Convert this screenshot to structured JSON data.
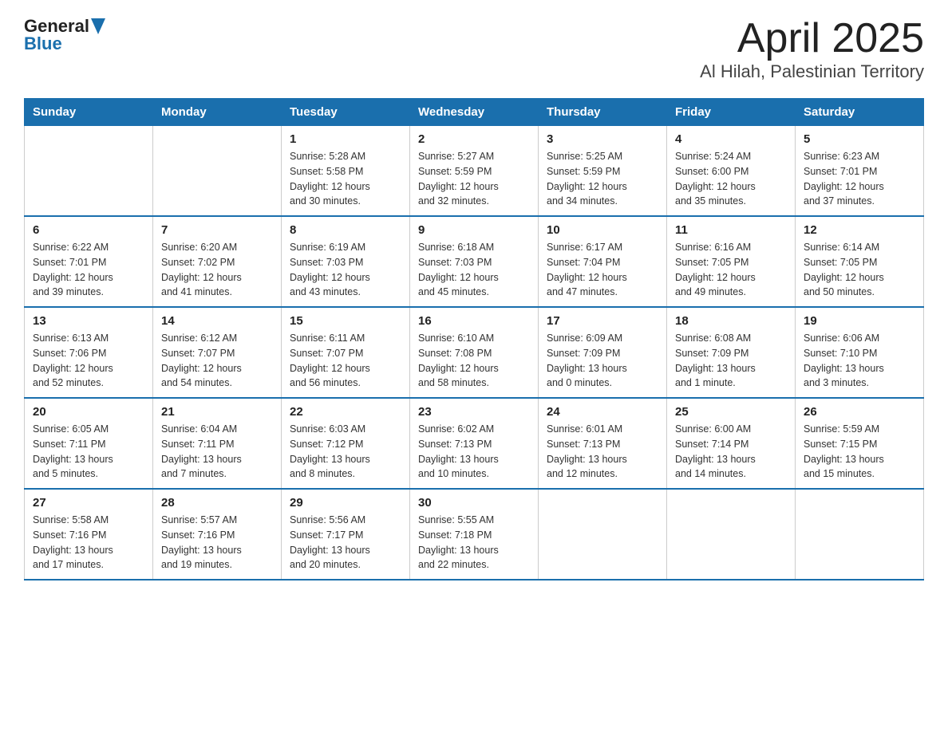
{
  "header": {
    "logo": {
      "general": "General",
      "blue": "Blue"
    },
    "title": "April 2025",
    "subtitle": "Al Hilah, Palestinian Territory"
  },
  "calendar": {
    "days_of_week": [
      "Sunday",
      "Monday",
      "Tuesday",
      "Wednesday",
      "Thursday",
      "Friday",
      "Saturday"
    ],
    "weeks": [
      [
        {
          "day": "",
          "info": ""
        },
        {
          "day": "",
          "info": ""
        },
        {
          "day": "1",
          "info": "Sunrise: 5:28 AM\nSunset: 5:58 PM\nDaylight: 12 hours\nand 30 minutes."
        },
        {
          "day": "2",
          "info": "Sunrise: 5:27 AM\nSunset: 5:59 PM\nDaylight: 12 hours\nand 32 minutes."
        },
        {
          "day": "3",
          "info": "Sunrise: 5:25 AM\nSunset: 5:59 PM\nDaylight: 12 hours\nand 34 minutes."
        },
        {
          "day": "4",
          "info": "Sunrise: 5:24 AM\nSunset: 6:00 PM\nDaylight: 12 hours\nand 35 minutes."
        },
        {
          "day": "5",
          "info": "Sunrise: 6:23 AM\nSunset: 7:01 PM\nDaylight: 12 hours\nand 37 minutes."
        }
      ],
      [
        {
          "day": "6",
          "info": "Sunrise: 6:22 AM\nSunset: 7:01 PM\nDaylight: 12 hours\nand 39 minutes."
        },
        {
          "day": "7",
          "info": "Sunrise: 6:20 AM\nSunset: 7:02 PM\nDaylight: 12 hours\nand 41 minutes."
        },
        {
          "day": "8",
          "info": "Sunrise: 6:19 AM\nSunset: 7:03 PM\nDaylight: 12 hours\nand 43 minutes."
        },
        {
          "day": "9",
          "info": "Sunrise: 6:18 AM\nSunset: 7:03 PM\nDaylight: 12 hours\nand 45 minutes."
        },
        {
          "day": "10",
          "info": "Sunrise: 6:17 AM\nSunset: 7:04 PM\nDaylight: 12 hours\nand 47 minutes."
        },
        {
          "day": "11",
          "info": "Sunrise: 6:16 AM\nSunset: 7:05 PM\nDaylight: 12 hours\nand 49 minutes."
        },
        {
          "day": "12",
          "info": "Sunrise: 6:14 AM\nSunset: 7:05 PM\nDaylight: 12 hours\nand 50 minutes."
        }
      ],
      [
        {
          "day": "13",
          "info": "Sunrise: 6:13 AM\nSunset: 7:06 PM\nDaylight: 12 hours\nand 52 minutes."
        },
        {
          "day": "14",
          "info": "Sunrise: 6:12 AM\nSunset: 7:07 PM\nDaylight: 12 hours\nand 54 minutes."
        },
        {
          "day": "15",
          "info": "Sunrise: 6:11 AM\nSunset: 7:07 PM\nDaylight: 12 hours\nand 56 minutes."
        },
        {
          "day": "16",
          "info": "Sunrise: 6:10 AM\nSunset: 7:08 PM\nDaylight: 12 hours\nand 58 minutes."
        },
        {
          "day": "17",
          "info": "Sunrise: 6:09 AM\nSunset: 7:09 PM\nDaylight: 13 hours\nand 0 minutes."
        },
        {
          "day": "18",
          "info": "Sunrise: 6:08 AM\nSunset: 7:09 PM\nDaylight: 13 hours\nand 1 minute."
        },
        {
          "day": "19",
          "info": "Sunrise: 6:06 AM\nSunset: 7:10 PM\nDaylight: 13 hours\nand 3 minutes."
        }
      ],
      [
        {
          "day": "20",
          "info": "Sunrise: 6:05 AM\nSunset: 7:11 PM\nDaylight: 13 hours\nand 5 minutes."
        },
        {
          "day": "21",
          "info": "Sunrise: 6:04 AM\nSunset: 7:11 PM\nDaylight: 13 hours\nand 7 minutes."
        },
        {
          "day": "22",
          "info": "Sunrise: 6:03 AM\nSunset: 7:12 PM\nDaylight: 13 hours\nand 8 minutes."
        },
        {
          "day": "23",
          "info": "Sunrise: 6:02 AM\nSunset: 7:13 PM\nDaylight: 13 hours\nand 10 minutes."
        },
        {
          "day": "24",
          "info": "Sunrise: 6:01 AM\nSunset: 7:13 PM\nDaylight: 13 hours\nand 12 minutes."
        },
        {
          "day": "25",
          "info": "Sunrise: 6:00 AM\nSunset: 7:14 PM\nDaylight: 13 hours\nand 14 minutes."
        },
        {
          "day": "26",
          "info": "Sunrise: 5:59 AM\nSunset: 7:15 PM\nDaylight: 13 hours\nand 15 minutes."
        }
      ],
      [
        {
          "day": "27",
          "info": "Sunrise: 5:58 AM\nSunset: 7:16 PM\nDaylight: 13 hours\nand 17 minutes."
        },
        {
          "day": "28",
          "info": "Sunrise: 5:57 AM\nSunset: 7:16 PM\nDaylight: 13 hours\nand 19 minutes."
        },
        {
          "day": "29",
          "info": "Sunrise: 5:56 AM\nSunset: 7:17 PM\nDaylight: 13 hours\nand 20 minutes."
        },
        {
          "day": "30",
          "info": "Sunrise: 5:55 AM\nSunset: 7:18 PM\nDaylight: 13 hours\nand 22 minutes."
        },
        {
          "day": "",
          "info": ""
        },
        {
          "day": "",
          "info": ""
        },
        {
          "day": "",
          "info": ""
        }
      ]
    ]
  }
}
